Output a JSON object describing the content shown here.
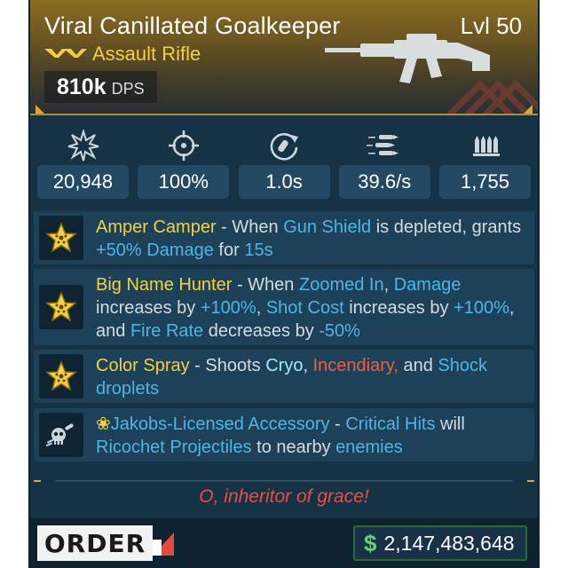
{
  "weapon": {
    "name": "Viral Canillated Goalkeeper",
    "level": "Lvl 50",
    "type": "Assault Rifle",
    "dps_value": "810k",
    "dps_unit": "DPS",
    "rarity_color": "#f5cf3a"
  },
  "stats": [
    {
      "icon": "damage-burst-icon",
      "value": "20,948"
    },
    {
      "icon": "accuracy-crosshair-icon",
      "value": "100%"
    },
    {
      "icon": "reload-time-icon",
      "value": "1.0s"
    },
    {
      "icon": "fire-rate-bullets-icon",
      "value": "39.6/s"
    },
    {
      "icon": "magazine-ammo-icon",
      "value": "1,755"
    }
  ],
  "perks": [
    {
      "icon": "star-perk-icon",
      "name": "Amper Camper",
      "t1": " - When ",
      "k1": "Gun Shield",
      "t2": " is depleted, grants ",
      "k2": "+50% Damage",
      "t3": " for ",
      "k3": "15s"
    },
    {
      "icon": "star-perk-icon",
      "name": "Big Name Hunter",
      "t1": " - When ",
      "k1": "Zoomed In",
      "t2": ", ",
      "k2": "Damage",
      "t3": " increases by ",
      "k3": "+100%",
      "t4": ", ",
      "k4": "Shot Cost",
      "t5": " increases by ",
      "k5": "+100%",
      "t6": ", and ",
      "k6": "Fire Rate",
      "t7": " decreases by ",
      "k7": "-50%"
    },
    {
      "icon": "star-perk-icon",
      "name": "Color Spray",
      "t1": " - Shoots ",
      "k_cryo": "Cryo",
      "t2": ", ",
      "k_fire": "Incendiary,",
      "t3": " and ",
      "k_shock": "Shock",
      "t4": " droplets"
    },
    {
      "icon": "skull-bullet-icon",
      "name": "Jakobs-Licensed Accessory",
      "t1": " - ",
      "k1": "Critical Hits",
      "t2": " will ",
      "k2": "Ricochet Projectiles",
      "t3": " to nearby ",
      "k3": "enemies"
    }
  ],
  "flavor_text": "O, inheritor of grace!",
  "manufacturer": "ORDER",
  "price": {
    "currency": "$",
    "value": "2,147,483,648"
  },
  "colors": {
    "background": "#163346",
    "perk_name": "#f3d23d",
    "keyword": "#4fb4e8",
    "cryo": "#a8e8ff",
    "incendiary": "#ef5f3e",
    "flavor": "#ef4a42",
    "price_green": "#5ed86a"
  }
}
